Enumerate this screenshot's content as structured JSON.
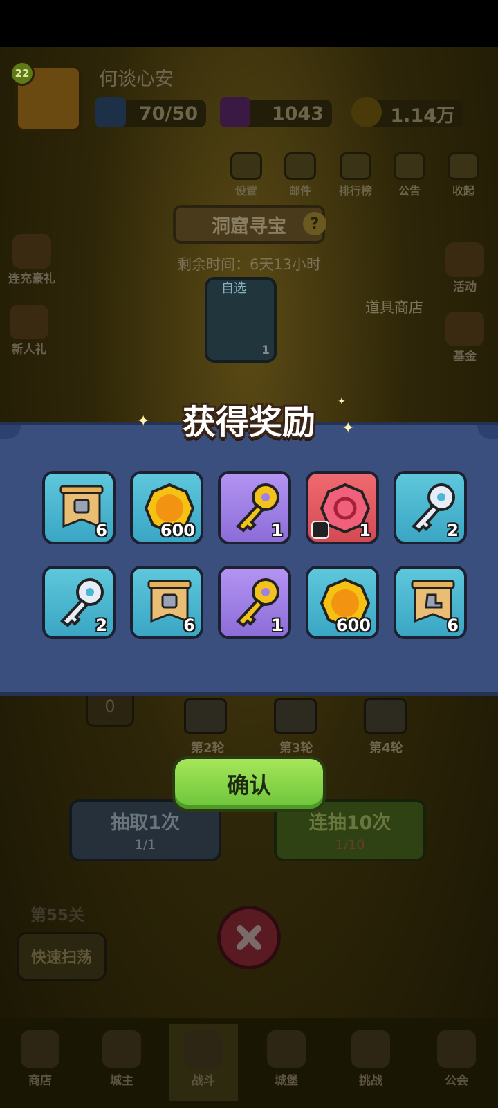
{
  "header": {
    "level": "22",
    "player_name": "何谈心安",
    "energy": "70/50",
    "gems": "1043",
    "gold": "1.14万"
  },
  "top_menu": [
    {
      "label": "设置",
      "icon": "gear-icon"
    },
    {
      "label": "邮件",
      "icon": "mail-icon"
    },
    {
      "label": "排行榜",
      "icon": "leaderboard-icon"
    },
    {
      "label": "公告",
      "icon": "megaphone-icon"
    },
    {
      "label": "收起",
      "icon": "collapse-icon"
    }
  ],
  "left_side": [
    {
      "label": "连充豪礼",
      "icon": "gift-icon"
    },
    {
      "label": "新人礼",
      "icon": "newbie-gift-icon"
    }
  ],
  "right_side": [
    {
      "label": "活动",
      "icon": "event-icon"
    },
    {
      "label": "基金",
      "icon": "fund-icon"
    }
  ],
  "event": {
    "title": "洞窟寻宝",
    "remaining_time": "剩余时间：6天13小时",
    "select_label": "自选",
    "chest_count": "1",
    "shop_label": "道具商店",
    "progress_value": "0",
    "rounds": [
      "第2轮",
      "第3轮",
      "第4轮"
    ],
    "draw_once_label": "抽取1次",
    "draw_once_count": "1/1",
    "draw_ten_label": "连抽10次",
    "draw_ten_count": "1/10",
    "stage_label": "第55关",
    "sweep_label": "快速扫荡"
  },
  "dialog": {
    "title": "获得奖励",
    "confirm_label": "确认",
    "rewards": [
      {
        "type": "armor-banner",
        "icon": "armor-banner-icon",
        "quantity": "6",
        "bg": "teal"
      },
      {
        "type": "gold-coin",
        "icon": "gold-coin-icon",
        "quantity": "600",
        "bg": "teal"
      },
      {
        "type": "gold-key",
        "icon": "gold-key-icon",
        "quantity": "1",
        "bg": "purple"
      },
      {
        "type": "ruby-gem",
        "icon": "ruby-gem-icon",
        "quantity": "1",
        "bg": "red"
      },
      {
        "type": "silver-key",
        "icon": "silver-key-icon",
        "quantity": "2",
        "bg": "teal"
      },
      {
        "type": "silver-key",
        "icon": "silver-key-icon",
        "quantity": "2",
        "bg": "teal"
      },
      {
        "type": "armor-banner",
        "icon": "armor-banner-icon",
        "quantity": "6",
        "bg": "teal"
      },
      {
        "type": "gold-key",
        "icon": "gold-key-icon",
        "quantity": "1",
        "bg": "purple"
      },
      {
        "type": "gold-coin",
        "icon": "gold-coin-icon",
        "quantity": "600",
        "bg": "teal"
      },
      {
        "type": "boot-banner",
        "icon": "boot-banner-icon",
        "quantity": "6",
        "bg": "teal"
      }
    ]
  },
  "bottom_nav": [
    {
      "label": "商店",
      "icon": "shop-icon"
    },
    {
      "label": "城主",
      "icon": "lord-icon"
    },
    {
      "label": "战斗",
      "icon": "battle-icon"
    },
    {
      "label": "城堡",
      "icon": "castle-icon"
    },
    {
      "label": "挑战",
      "icon": "challenge-icon"
    },
    {
      "label": "公会",
      "icon": "guild-icon"
    }
  ],
  "colors": {
    "panel_bg": "#3a4f7e",
    "confirm_green": "#8fd84a",
    "item_teal": "#4ab8d4",
    "item_purple": "#9f80e6",
    "item_red": "#e25a62"
  }
}
